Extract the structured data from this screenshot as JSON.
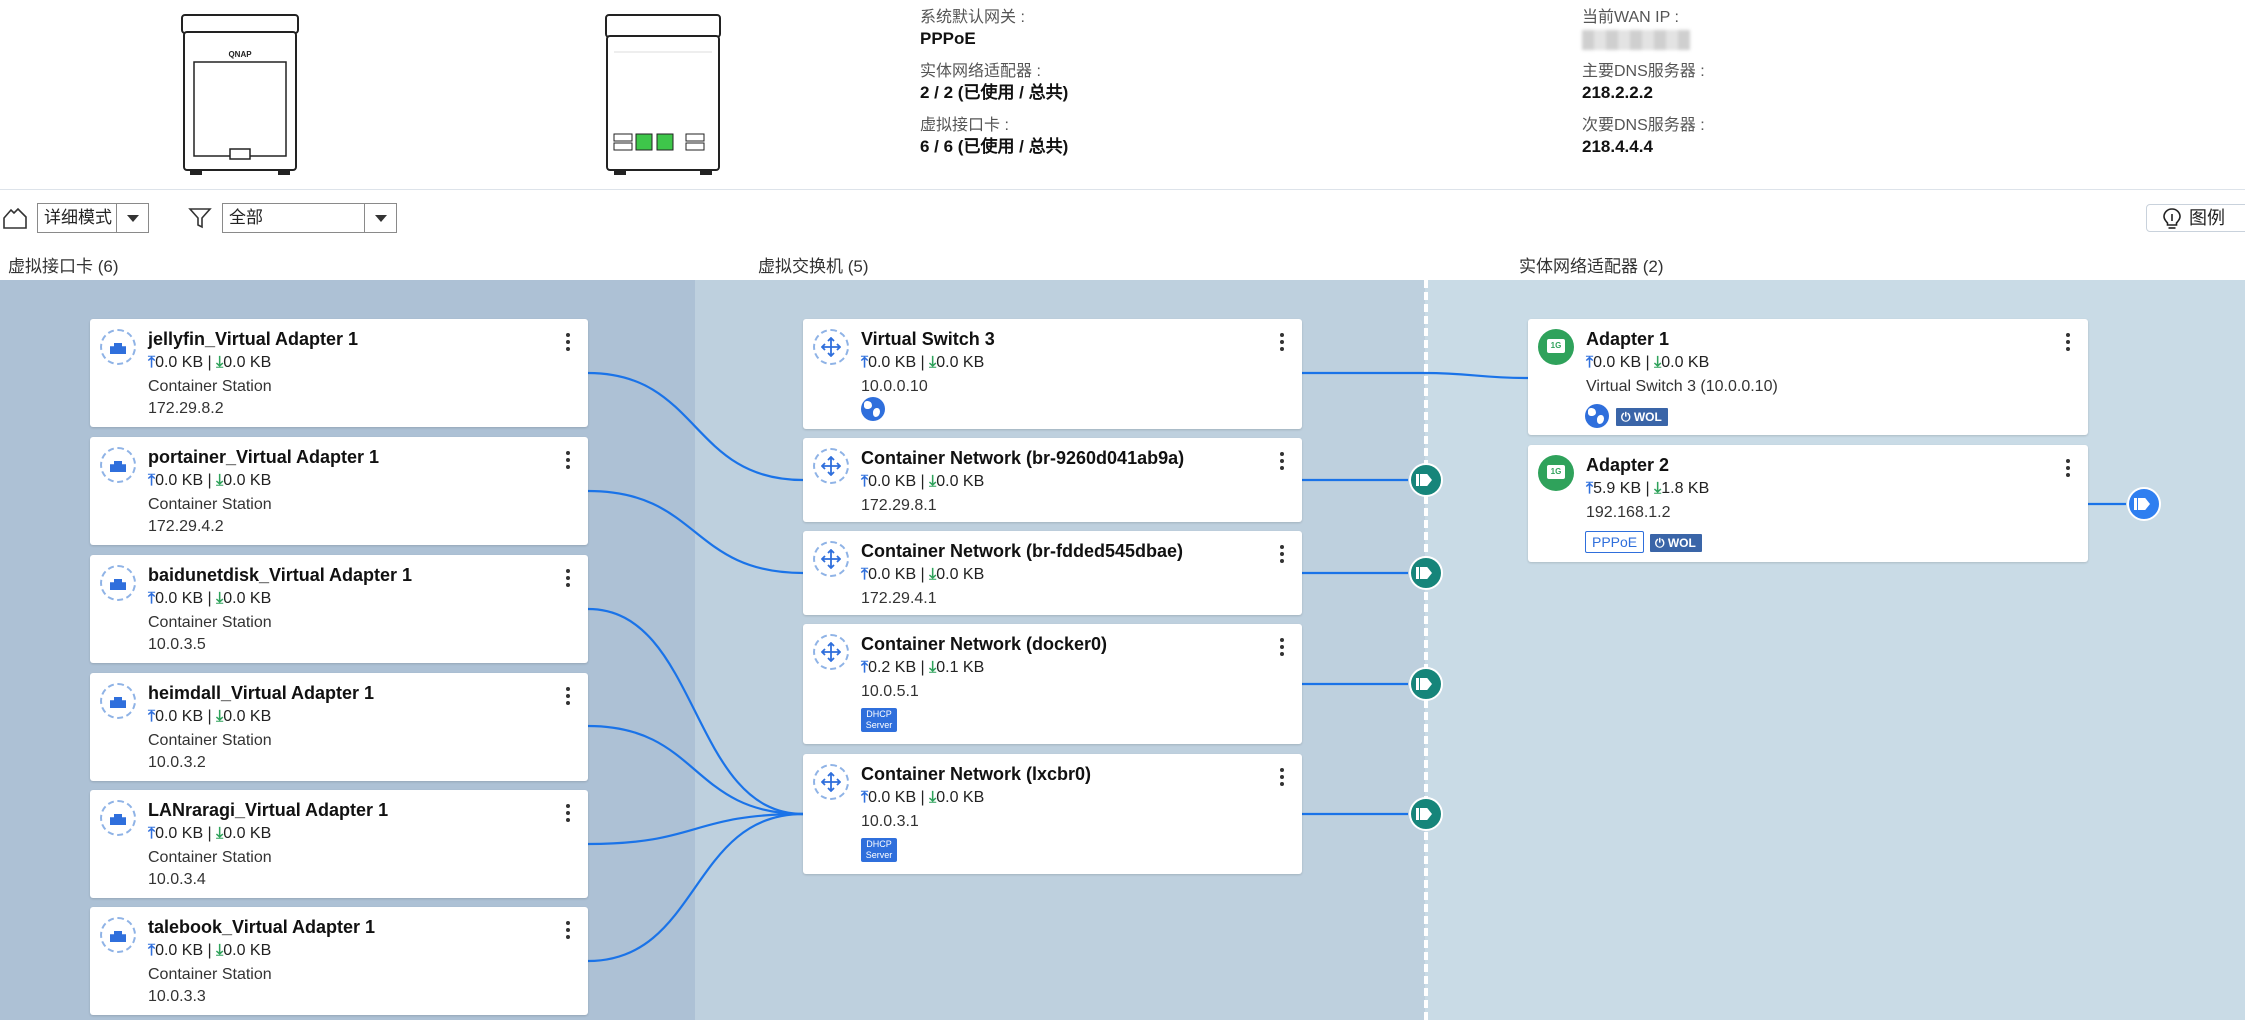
{
  "summary": {
    "gateway_label": "系统默认网关 :",
    "gateway_value": "PPPoE",
    "phys_label": "实体网络适配器 :",
    "phys_value": "2 / 2 (已使用 / 总共)",
    "vnic_label": "虚拟接口卡 :",
    "vnic_value": "6 / 6 (已使用 / 总共)",
    "wan_label": "当前WAN IP :",
    "dns1_label": "主要DNS服务器 :",
    "dns1_value": "218.2.2.2",
    "dns2_label": "次要DNS服务器 :",
    "dns2_value": "218.4.4.4",
    "nas_logo": "QNAP"
  },
  "toolbar": {
    "mode_value": "详细模式",
    "filter_value": "全部",
    "legend_label": "图例"
  },
  "columns": {
    "vnic": "虚拟接口卡 (6)",
    "vswitch": "虚拟交换机 (5)",
    "pnic": "实体网络适配器 (2)"
  },
  "vnics": [
    {
      "name": "jellyfin_Virtual Adapter 1",
      "up": "0.0 KB",
      "down": "0.0 KB",
      "source": "Container Station",
      "ip": "172.29.8.2"
    },
    {
      "name": "portainer_Virtual Adapter 1",
      "up": "0.0 KB",
      "down": "0.0 KB",
      "source": "Container Station",
      "ip": "172.29.4.2"
    },
    {
      "name": "baidunetdisk_Virtual Adapter 1",
      "up": "0.0 KB",
      "down": "0.0 KB",
      "source": "Container Station",
      "ip": "10.0.3.5"
    },
    {
      "name": "heimdall_Virtual Adapter 1",
      "up": "0.0 KB",
      "down": "0.0 KB",
      "source": "Container Station",
      "ip": "10.0.3.2"
    },
    {
      "name": "LANraragi_Virtual Adapter 1",
      "up": "0.0 KB",
      "down": "0.0 KB",
      "source": "Container Station",
      "ip": "10.0.3.4"
    },
    {
      "name": "talebook_Virtual Adapter 1",
      "up": "0.0 KB",
      "down": "0.0 KB",
      "source": "Container Station",
      "ip": "10.0.3.3"
    }
  ],
  "vswitches": [
    {
      "name": "Virtual Switch 3",
      "up": "0.0 KB",
      "down": "0.0 KB",
      "ip": "10.0.0.10"
    },
    {
      "name": "Container Network (br-9260d041ab9a)",
      "up": "0.0 KB",
      "down": "0.0 KB",
      "ip": "172.29.8.1"
    },
    {
      "name": "Container Network (br-fdded545dbae)",
      "up": "0.0 KB",
      "down": "0.0 KB",
      "ip": "172.29.4.1"
    },
    {
      "name": "Container Network (docker0)",
      "up": "0.2 KB",
      "down": "0.1 KB",
      "ip": "10.0.5.1",
      "dhcp_line1": "DHCP",
      "dhcp_line2": "Server"
    },
    {
      "name": "Container Network (lxcbr0)",
      "up": "0.0 KB",
      "down": "0.0 KB",
      "ip": "10.0.3.1",
      "dhcp_line1": "DHCP",
      "dhcp_line2": "Server"
    }
  ],
  "adapters": [
    {
      "name": "Adapter 1",
      "up": "0.0 KB",
      "down": "0.0 KB",
      "detail": "Virtual Switch 3 (10.0.0.10)",
      "wol": "WOL"
    },
    {
      "name": "Adapter 2",
      "up": "5.9 KB",
      "down": "1.8 KB",
      "detail": "192.168.1.2",
      "pppoe": "PPPoE",
      "wol": "WOL"
    }
  ],
  "colors": {
    "wire": "#1a73e8",
    "accent": "#2f6fdc",
    "port": "#16857a",
    "adapter": "#2fa25b"
  }
}
